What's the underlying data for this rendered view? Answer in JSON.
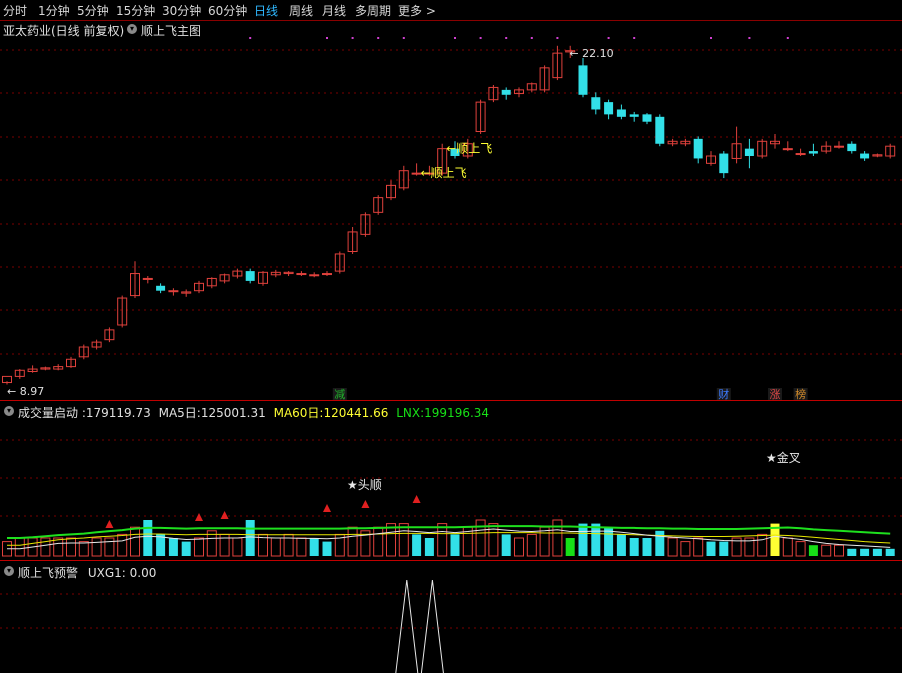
{
  "tabs": [
    "分时",
    "1分钟",
    "5分钟",
    "15分钟",
    "30分钟",
    "60分钟",
    "日线",
    "周线",
    "月线",
    "多周期",
    "更多 >"
  ],
  "active_tab": "日线",
  "main": {
    "stock": "亚太药业(日线 前复权)",
    "indicator": "顺上飞主图",
    "high_label": "22.10",
    "low_label": "8.97",
    "signal_label": "顺上飞",
    "markers": [
      {
        "text": "减",
        "color": "#1fb32a",
        "candle": 26
      },
      {
        "text": "财",
        "color": "#3d7bff",
        "candle": 56
      },
      {
        "text": "涨",
        "color": "#e04848",
        "candle": 60
      },
      {
        "text": "榜",
        "color": "#d08a2a",
        "candle": 62
      }
    ]
  },
  "volume_panel": {
    "name": "成交量启动",
    "value": "179119.73",
    "ma5_label": "MA5日:",
    "ma5": "125001.31",
    "ma60_label": "MA60日:",
    "ma60": "120441.66",
    "lnx_label": "LNX:",
    "lnx": "199196.34",
    "ann_head": "★头顺",
    "ann_cross": "★金叉"
  },
  "warn_panel": {
    "name": "顺上飞预警",
    "uxg_label": "UXG1:",
    "uxg": "0.00"
  },
  "colors": {
    "up": "#e0413c",
    "down": "#32e0e8",
    "yellow": "#ffff33",
    "green": "#17e017",
    "accent": "#2fb8ff",
    "grid": "#7a0000"
  },
  "chart_data": {
    "type": "candlestick",
    "price_ylim": [
      8.5,
      23.2
    ],
    "candles": [
      [
        9.05,
        9.3,
        9.1,
        8.97
      ],
      [
        9.3,
        9.55,
        9.6,
        9.2
      ],
      [
        9.5,
        9.6,
        9.75,
        9.45
      ],
      [
        9.6,
        9.65,
        9.7,
        9.55
      ],
      [
        9.6,
        9.7,
        9.8,
        9.55
      ],
      [
        9.7,
        10.0,
        10.1,
        9.65
      ],
      [
        10.1,
        10.5,
        10.6,
        10.0
      ],
      [
        10.5,
        10.7,
        10.8,
        10.4
      ],
      [
        10.8,
        11.2,
        11.3,
        10.7
      ],
      [
        11.4,
        12.5,
        12.6,
        11.3
      ],
      [
        12.6,
        13.5,
        14.0,
        12.5
      ],
      [
        13.3,
        13.3,
        13.4,
        13.1
      ],
      [
        13.0,
        12.8,
        13.1,
        12.7
      ],
      [
        12.8,
        12.8,
        12.9,
        12.6
      ],
      [
        12.7,
        12.75,
        12.85,
        12.55
      ],
      [
        12.8,
        13.1,
        13.2,
        12.7
      ],
      [
        13.0,
        13.3,
        13.35,
        12.9
      ],
      [
        13.2,
        13.45,
        13.5,
        13.1
      ],
      [
        13.4,
        13.6,
        13.7,
        13.3
      ],
      [
        13.6,
        13.2,
        13.7,
        13.1
      ],
      [
        13.1,
        13.55,
        13.6,
        13.0
      ],
      [
        13.45,
        13.55,
        13.65,
        13.35
      ],
      [
        13.5,
        13.55,
        13.6,
        13.4
      ],
      [
        13.5,
        13.5,
        13.6,
        13.4
      ],
      [
        13.45,
        13.45,
        13.55,
        13.35
      ],
      [
        13.5,
        13.5,
        13.6,
        13.4
      ],
      [
        13.6,
        14.3,
        14.4,
        13.5
      ],
      [
        14.4,
        15.2,
        15.4,
        14.3
      ],
      [
        15.1,
        15.9,
        16.0,
        15.0
      ],
      [
        16.0,
        16.6,
        16.7,
        15.9
      ],
      [
        16.6,
        17.1,
        17.3,
        16.5
      ],
      [
        17.0,
        17.7,
        17.9,
        16.9
      ],
      [
        17.6,
        17.6,
        18.0,
        17.5
      ],
      [
        17.6,
        17.6,
        17.9,
        17.5
      ],
      [
        17.6,
        18.6,
        18.8,
        17.5
      ],
      [
        18.6,
        18.3,
        18.9,
        18.2
      ],
      [
        18.3,
        18.8,
        19.0,
        18.2
      ],
      [
        19.3,
        20.5,
        20.6,
        19.2
      ],
      [
        20.6,
        21.1,
        21.2,
        20.5
      ],
      [
        21.0,
        20.8,
        21.1,
        20.6
      ],
      [
        20.85,
        21.0,
        21.1,
        20.7
      ],
      [
        21.0,
        21.25,
        21.3,
        20.9
      ],
      [
        21.0,
        21.9,
        22.0,
        20.9
      ],
      [
        21.5,
        22.5,
        22.8,
        21.4
      ],
      [
        22.55,
        22.6,
        22.8,
        22.3
      ],
      [
        22.0,
        20.8,
        22.3,
        20.7
      ],
      [
        20.7,
        20.2,
        20.9,
        20.0
      ],
      [
        20.5,
        20.0,
        20.6,
        19.8
      ],
      [
        20.2,
        19.9,
        20.4,
        19.8
      ],
      [
        20.0,
        19.9,
        20.1,
        19.7
      ],
      [
        20.0,
        19.7,
        20.05,
        19.6
      ],
      [
        19.9,
        18.8,
        20.0,
        18.7
      ],
      [
        18.8,
        18.9,
        19.0,
        18.7
      ],
      [
        18.8,
        18.9,
        19.0,
        18.7
      ],
      [
        19.0,
        18.2,
        19.1,
        18.0
      ],
      [
        18.0,
        18.3,
        18.5,
        17.9
      ],
      [
        18.4,
        17.6,
        18.5,
        17.4
      ],
      [
        18.2,
        18.8,
        19.5,
        18.0
      ],
      [
        18.6,
        18.3,
        19.0,
        17.8
      ],
      [
        18.3,
        18.9,
        19.0,
        18.2
      ],
      [
        18.8,
        18.9,
        19.2,
        18.6
      ],
      [
        18.6,
        18.6,
        18.9,
        18.5
      ],
      [
        18.4,
        18.4,
        18.6,
        18.3
      ],
      [
        18.5,
        18.4,
        18.8,
        18.3
      ],
      [
        18.5,
        18.7,
        18.9,
        18.4
      ],
      [
        18.7,
        18.7,
        18.9,
        18.6
      ],
      [
        18.8,
        18.5,
        18.9,
        18.4
      ],
      [
        18.4,
        18.2,
        18.5,
        18.1
      ],
      [
        18.3,
        18.35,
        18.4,
        18.25
      ],
      [
        18.3,
        18.7,
        18.8,
        18.2
      ]
    ],
    "volumes": [
      [
        4,
        "r"
      ],
      [
        5,
        "r"
      ],
      [
        5,
        "r"
      ],
      [
        5,
        "r"
      ],
      [
        5,
        "r"
      ],
      [
        5,
        "r"
      ],
      [
        4,
        "r"
      ],
      [
        5,
        "r"
      ],
      [
        5,
        "r"
      ],
      [
        6,
        "r"
      ],
      [
        8,
        "r"
      ],
      [
        10,
        "c"
      ],
      [
        6,
        "c"
      ],
      [
        5,
        "c"
      ],
      [
        4,
        "c"
      ],
      [
        5,
        "r"
      ],
      [
        7,
        "r"
      ],
      [
        6,
        "r"
      ],
      [
        5,
        "r"
      ],
      [
        10,
        "c"
      ],
      [
        6,
        "r"
      ],
      [
        5,
        "r"
      ],
      [
        6,
        "r"
      ],
      [
        5,
        "r"
      ],
      [
        5,
        "c"
      ],
      [
        4,
        "c"
      ],
      [
        6,
        "r"
      ],
      [
        8,
        "r"
      ],
      [
        7,
        "r"
      ],
      [
        8,
        "r"
      ],
      [
        9,
        "r"
      ],
      [
        9,
        "r"
      ],
      [
        6,
        "c"
      ],
      [
        5,
        "c"
      ],
      [
        9,
        "r"
      ],
      [
        6,
        "c"
      ],
      [
        8,
        "r"
      ],
      [
        10,
        "r"
      ],
      [
        9,
        "r"
      ],
      [
        6,
        "c"
      ],
      [
        5,
        "r"
      ],
      [
        6,
        "r"
      ],
      [
        8,
        "r"
      ],
      [
        10,
        "r"
      ],
      [
        5,
        "g"
      ],
      [
        9,
        "c"
      ],
      [
        9,
        "c"
      ],
      [
        8,
        "c"
      ],
      [
        6,
        "c"
      ],
      [
        5,
        "c"
      ],
      [
        5,
        "c"
      ],
      [
        7,
        "c"
      ],
      [
        5,
        "r"
      ],
      [
        4,
        "r"
      ],
      [
        5,
        "r"
      ],
      [
        4,
        "c"
      ],
      [
        4,
        "c"
      ],
      [
        5,
        "r"
      ],
      [
        5,
        "r"
      ],
      [
        6,
        "r"
      ],
      [
        9,
        "y"
      ],
      [
        5,
        "r"
      ],
      [
        4,
        "r"
      ],
      [
        3,
        "g"
      ],
      [
        3,
        "r"
      ],
      [
        3,
        "r"
      ],
      [
        2,
        "c"
      ],
      [
        2,
        "c"
      ],
      [
        2,
        "c"
      ],
      [
        2,
        "c"
      ]
    ],
    "green_line": [
      5,
      5,
      5.2,
      5.5,
      5.8,
      6.0,
      6.2,
      6.6,
      6.9,
      7.2,
      7.6,
      7.8,
      7.8,
      7.7,
      7.6,
      7.7,
      7.7,
      7.7,
      7.7,
      7.6,
      7.6,
      7.6,
      7.6,
      7.6,
      7.6,
      7.6,
      7.6,
      7.7,
      7.7,
      7.8,
      7.9,
      8.0,
      8.0,
      8.0,
      8.0,
      8.0,
      8.1,
      8.2,
      8.3,
      8.3,
      8.3,
      8.3,
      8.2,
      8.2,
      8.2,
      8.1,
      8.0,
      7.9,
      7.8,
      7.8,
      7.7,
      7.7,
      7.6,
      7.6,
      7.5,
      7.5,
      7.5,
      7.5,
      7.6,
      7.7,
      7.8,
      7.9,
      7.7,
      7.4,
      7.2,
      7.0,
      6.8,
      6.6,
      6.4,
      6.2
    ],
    "yellow_line": [
      3,
      3,
      3.5,
      4.0,
      4.5,
      4.8,
      5.0,
      5.3,
      5.5,
      5.7,
      6.0,
      6.1,
      6.1,
      6.0,
      5.9,
      6.0,
      6.0,
      6.0,
      6.0,
      5.9,
      5.9,
      5.9,
      5.9,
      5.9,
      5.9,
      5.9,
      5.9,
      6.0,
      6.0,
      6.1,
      6.2,
      6.3,
      6.3,
      6.3,
      6.2,
      6.2,
      6.3,
      6.4,
      6.5,
      6.5,
      6.5,
      6.5,
      6.4,
      6.4,
      6.4,
      6.3,
      6.2,
      6.1,
      6.0,
      5.9,
      5.8,
      5.7,
      5.6,
      5.5,
      5.4,
      5.4,
      5.4,
      5.5,
      5.6,
      5.7,
      5.8,
      5.7,
      5.5,
      5.2,
      4.9,
      4.6,
      4.3,
      4.0,
      3.8,
      3.6
    ],
    "white_line": [
      2,
      2,
      2.5,
      3.0,
      3.5,
      3.6,
      3.6,
      3.8,
      4.0,
      4.2,
      5.2,
      5.5,
      5.3,
      4.9,
      4.6,
      4.7,
      4.9,
      5.0,
      5.0,
      5.3,
      5.1,
      5.0,
      5.0,
      4.9,
      4.9,
      4.8,
      5.0,
      5.5,
      5.8,
      6.2,
      6.6,
      7.0,
      6.8,
      6.5,
      6.8,
      6.5,
      6.8,
      7.2,
      7.5,
      7.2,
      6.9,
      6.8,
      7.0,
      7.3,
      6.8,
      6.8,
      6.9,
      6.9,
      6.6,
      6.2,
      5.8,
      5.5,
      5.2,
      5.0,
      4.8,
      4.5,
      4.3,
      4.2,
      4.2,
      4.5,
      5.5,
      5.0,
      4.6,
      4.0,
      3.5,
      3.2,
      3.0,
      2.8,
      2.6,
      2.4
    ],
    "red_triangles": [
      8,
      15,
      17,
      25,
      28,
      32
    ],
    "warn_spikes": [
      31,
      33
    ],
    "magenta_dots": [
      19,
      25,
      27,
      29,
      31,
      35,
      37,
      39,
      41,
      43,
      47,
      49,
      55,
      58,
      61
    ]
  }
}
